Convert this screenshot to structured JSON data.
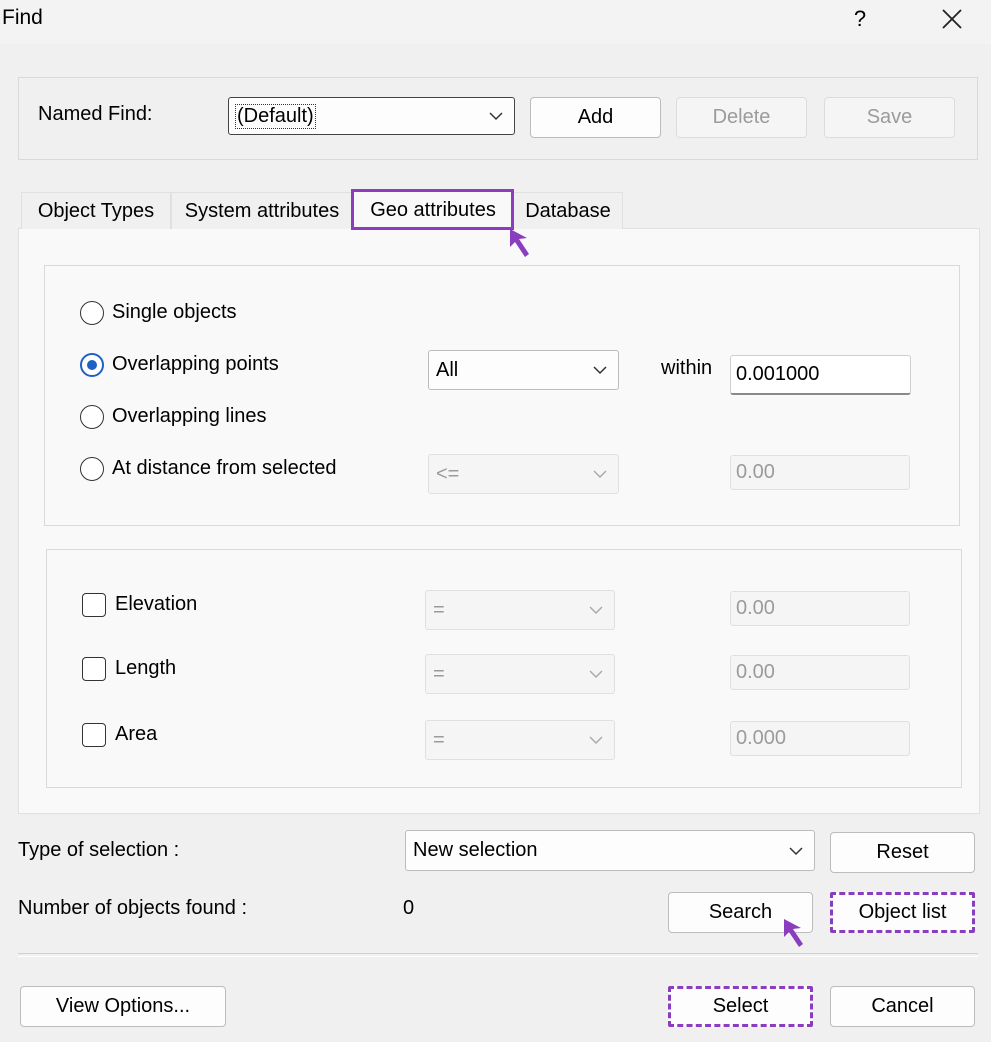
{
  "window": {
    "title": "Find",
    "help_glyph": "?"
  },
  "named_find": {
    "label": "Named Find:",
    "selected": "(Default)",
    "add_label": "Add",
    "delete_label": "Delete",
    "save_label": "Save"
  },
  "tabs": [
    {
      "label": "Object Types",
      "active": false
    },
    {
      "label": "System attributes",
      "active": false
    },
    {
      "label": "Geo attributes",
      "active": true
    },
    {
      "label": "Database",
      "active": false
    }
  ],
  "geo": {
    "single_objects": "Single objects",
    "overlapping_points": "Overlapping points",
    "overlapping_lines": "Overlapping lines",
    "at_distance": "At distance from selected",
    "selected_option": "Overlapping points",
    "points_scope": "All",
    "within_label": "within",
    "within_value": "0.001000",
    "distance_operator": "<=",
    "distance_value": "0.00"
  },
  "filters": [
    {
      "label": "Elevation",
      "operator": "=",
      "value": "0.00"
    },
    {
      "label": "Length",
      "operator": "=",
      "value": "0.00"
    },
    {
      "label": "Area",
      "operator": "=",
      "value": "0.000"
    }
  ],
  "selection": {
    "type_label": "Type of selection :",
    "type_value": "New selection",
    "reset_label": "Reset",
    "count_label": "Number of objects found :",
    "count_value": "0",
    "search_label": "Search",
    "object_list_label": "Object list"
  },
  "footer": {
    "view_options_label": "View Options...",
    "select_label": "Select",
    "cancel_label": "Cancel"
  },
  "colors": {
    "annotation": "#8b3dbf",
    "radio_selected": "#1f60c4",
    "background": "#f0f0f0"
  },
  "icons": {
    "close": "close-icon",
    "chevron": "chevron-down-icon",
    "pointer": "annotation-arrow-icon"
  }
}
